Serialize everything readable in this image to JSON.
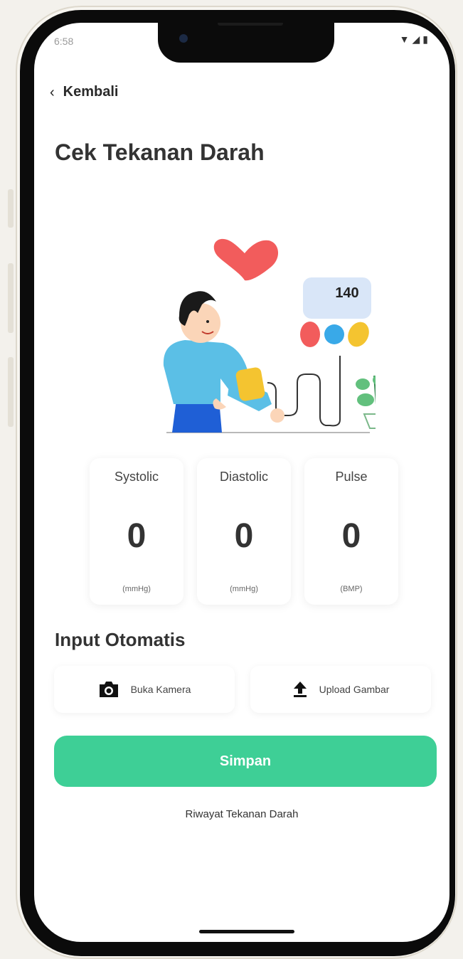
{
  "status_bar": {
    "time": "6:58"
  },
  "nav": {
    "back_label": "Kembali"
  },
  "page": {
    "title": "Cek Tekanan Darah"
  },
  "illustration": {
    "monitor_reading": "140"
  },
  "readings": [
    {
      "label": "Systolic",
      "value": "0",
      "unit": "(mmHg)"
    },
    {
      "label": "Diastolic",
      "value": "0",
      "unit": "(mmHg)"
    },
    {
      "label": "Pulse",
      "value": "0",
      "unit": "(BMP)"
    }
  ],
  "auto_input": {
    "title": "Input Otomatis",
    "camera_label": "Buka Kamera",
    "camera_icon": "camera-icon",
    "upload_label": "Upload Gambar",
    "upload_icon": "upload-icon"
  },
  "actions": {
    "save_label": "Simpan",
    "history_label": "Riwayat Tekanan Darah"
  },
  "colors": {
    "accent": "#3ecf96",
    "heart": "#f25c5c",
    "shirt": "#5bbfe6",
    "pants": "#1f5fd6",
    "cuff": "#f4c430"
  }
}
